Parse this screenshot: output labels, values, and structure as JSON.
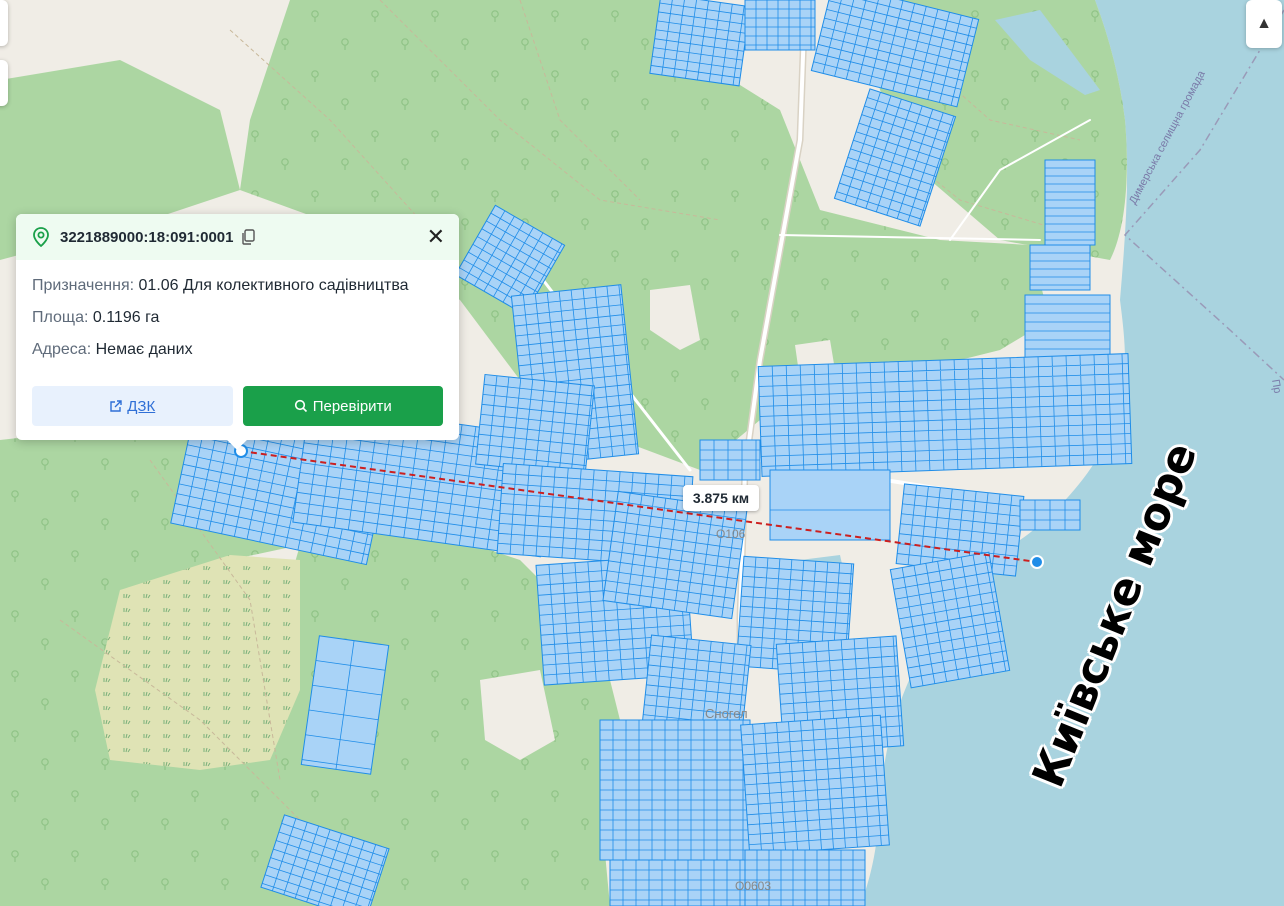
{
  "popup": {
    "cadastral_number": "3221889000:18:091:0001",
    "rows": [
      {
        "label": "Призначення:",
        "value": "01.06 Для колективного садівництва"
      },
      {
        "label": "Площа:",
        "value": "0.1196 га"
      },
      {
        "label": "Адреса:",
        "value": "Немає даних"
      }
    ],
    "btn_dzk": "ДЗК",
    "btn_check": "Перевірити",
    "close": "✕"
  },
  "distance_label": "3.875 км",
  "sea_label": "Київське море",
  "boundary_label": "Димерська селищна громада",
  "edge_label": "Пр",
  "road_labels": [
    "О106",
    "Лютіж",
    "Сногел",
    "О0603"
  ],
  "compass": "▲",
  "colors": {
    "forest": "#acd6a2",
    "clearing": "#f0ede6",
    "water": "#a9d3df",
    "parcel_fill": "#a9d3f7",
    "parcel_stroke": "#1f8de8",
    "measure_line": "#cc1f1f",
    "accent_green": "#1aa04a",
    "link_blue": "#2f6fd6"
  }
}
